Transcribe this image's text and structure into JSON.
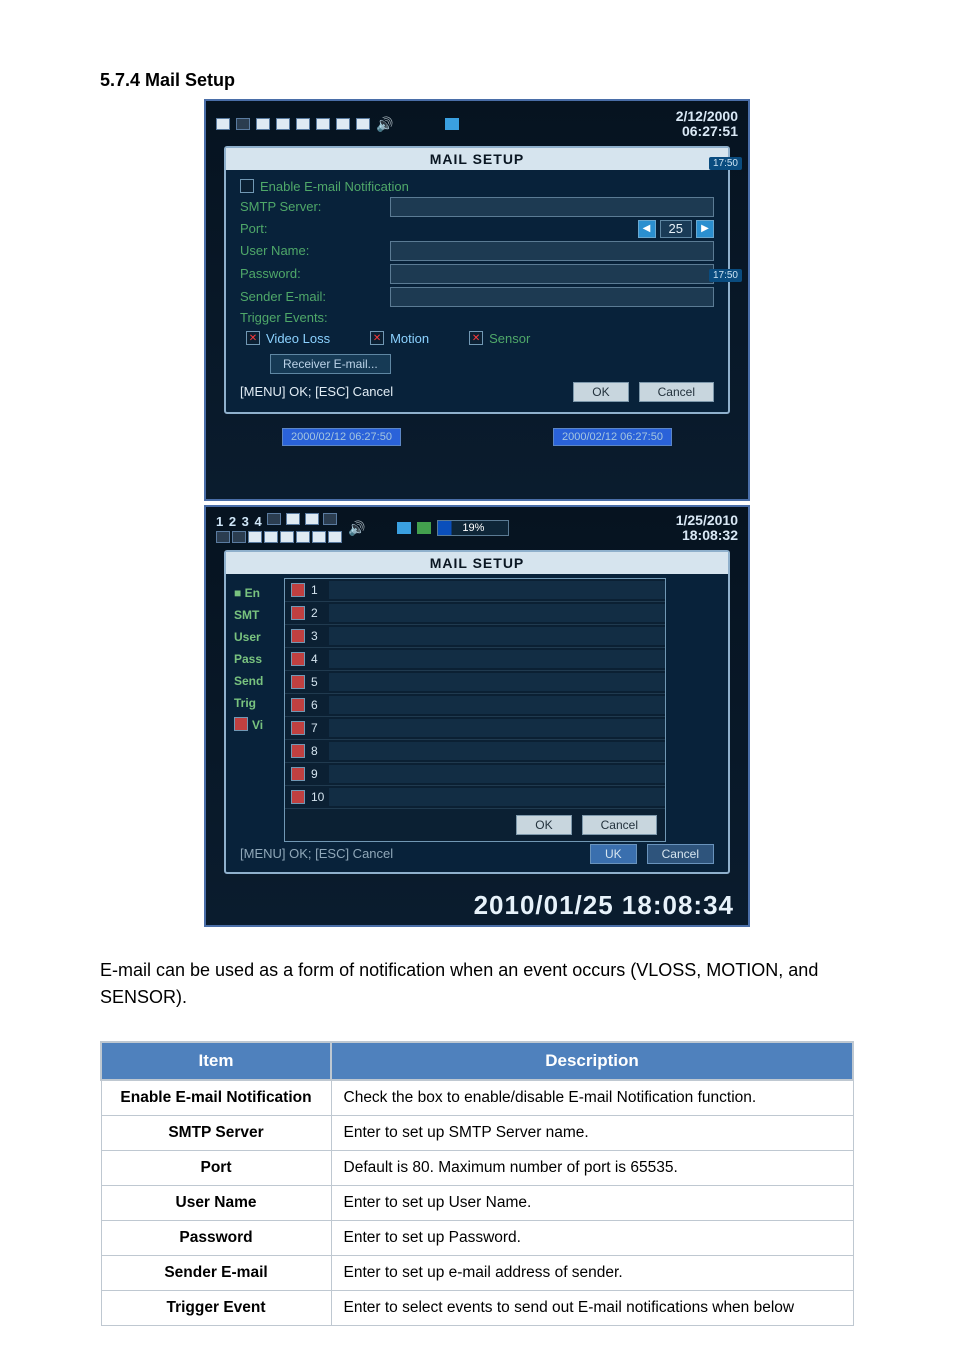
{
  "heading": "5.7.4 Mail Setup",
  "shot1": {
    "date": "2/12/2000",
    "time": "06:27:51",
    "badge1": "17:50",
    "badge2": "17:50",
    "dialog_title": "MAIL SETUP",
    "enable_label": "Enable E-mail Notification",
    "smtp_label": "SMTP Server:",
    "port_label": "Port:",
    "port_value": "25",
    "user_label": "User Name:",
    "pass_label": "Password:",
    "sender_label": "Sender E-mail:",
    "trigger_label": "Trigger Events:",
    "trig_vloss": "Video Loss",
    "trig_motion": "Motion",
    "trig_sensor": "Sensor",
    "recv_btn": "Receiver E-mail...",
    "hint": "[MENU] OK; [ESC] Cancel",
    "ok": "OK",
    "cancel": "Cancel",
    "ts_left": "2000/02/12 06:27:50",
    "ts_right": "2000/02/12 06:27:50"
  },
  "shot2": {
    "digits": "1 2 3 4",
    "date": "1/25/2010",
    "time": "18:08:32",
    "percent": "19%",
    "dialog_title": "MAIL SETUP",
    "left": {
      "en": "En",
      "smt": "SMT",
      "user": "User",
      "pass": "Pass",
      "send": "Send",
      "trig": "Trig",
      "vi": "Vi"
    },
    "rows": [
      "1",
      "2",
      "3",
      "4",
      "5",
      "6",
      "7",
      "8",
      "9",
      "10"
    ],
    "ok": "OK",
    "cancel": "Cancel",
    "hint": "[MENU] OK; [ESC] Cancel",
    "uk": "UK",
    "cancel2": "Cancel",
    "bigtime": "2010/01/25 18:08:34"
  },
  "body_text": "E-mail can be used as a form of notification when an event occurs (VLOSS, MOTION, and SENSOR).",
  "table": {
    "head_item": "Item",
    "head_desc": "Description",
    "rows": [
      {
        "item": "Enable E-mail Notification",
        "desc": "Check the box to enable/disable E-mail Notification function."
      },
      {
        "item": "SMTP Server",
        "desc": "Enter to set up SMTP Server name."
      },
      {
        "item": "Port",
        "desc": "Default is 80. Maximum number of port is 65535."
      },
      {
        "item": "User Name",
        "desc": "Enter to set up User Name."
      },
      {
        "item": "Password",
        "desc": "Enter to set up Password."
      },
      {
        "item": "Sender E-mail",
        "desc": "Enter to set up e-mail address of sender."
      },
      {
        "item": "Trigger Event",
        "desc": "Enter to select events to send out E-mail notifications when below"
      }
    ]
  }
}
